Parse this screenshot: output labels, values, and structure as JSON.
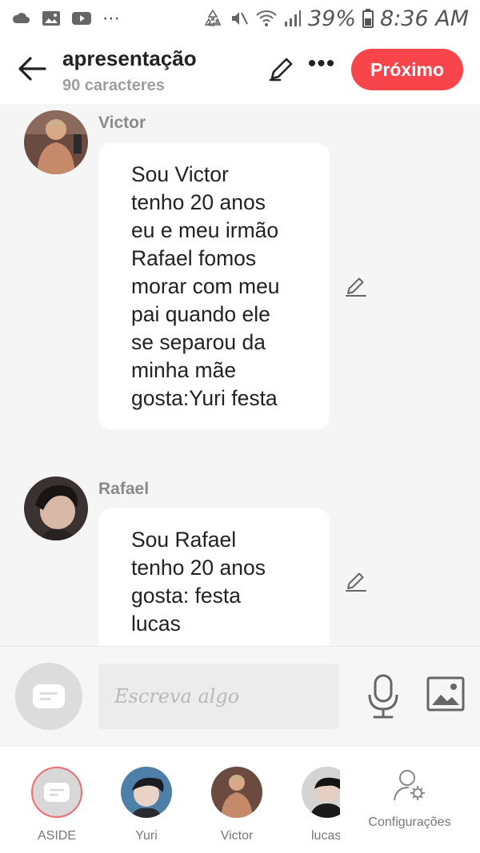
{
  "statusbar": {
    "battery_percent": "39%",
    "time": "8:36 AM",
    "left_icons": [
      "cloud-icon",
      "image-icon",
      "youtube-icon",
      "more-icon"
    ],
    "right_icons": [
      "recycle-icon",
      "mute-icon",
      "wifi-icon",
      "signal-icon",
      "battery-icon"
    ]
  },
  "header": {
    "title": "apresentação",
    "subtitle": "90 caracteres",
    "next_label": "Próximo"
  },
  "messages": [
    {
      "author": "Victor",
      "text": "Sou Victor\ntenho 20 anos\neu e meu irmão\nRafael fomos\nmorar com meu\npai quando ele\nse separou da\nminha mãe\ngosta:Yuri festa"
    },
    {
      "author": "Rafael",
      "text": "Sou Rafael\ntenho 20 anos\ngosta: festa\nlucas"
    }
  ],
  "composer": {
    "placeholder": "Escreva algo"
  },
  "tabs": [
    {
      "label": "ASIDE"
    },
    {
      "label": "Yuri"
    },
    {
      "label": "Victor"
    },
    {
      "label": "lucas"
    },
    {
      "label": "Configurações"
    }
  ],
  "colors": {
    "accent": "#f7454b",
    "background": "#f5f5f5",
    "muted_text": "#8a8a8a"
  }
}
